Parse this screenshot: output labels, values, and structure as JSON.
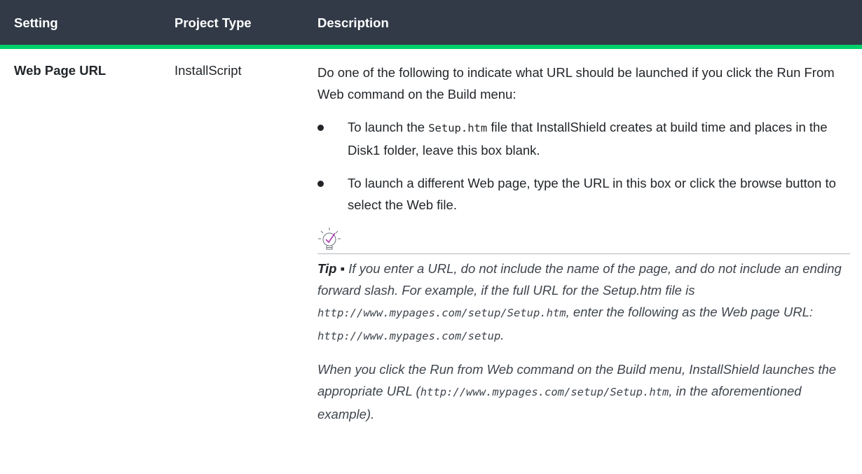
{
  "table": {
    "headers": {
      "setting": "Setting",
      "project_type": "Project Type",
      "description": "Description"
    },
    "row": {
      "setting": "Web Page URL",
      "project_type": "InstallScript",
      "intro": "Do one of the following to indicate what URL should be launched if you click the Run From Web command on the Build menu:",
      "bullets": [
        {
          "before": "To launch the ",
          "code": "Setup.htm",
          "after": " file that InstallShield creates at build time and places in the Disk1 folder, leave this box blank."
        },
        {
          "text": "To launch a different Web page, type the URL in this box or click the browse button to select the Web file."
        }
      ],
      "tip": {
        "icon": "lightbulb-check-icon",
        "label": "Tip",
        "separator": " ▪ ",
        "p1_a": "If you enter a URL, do not include the name of the page, and do not include an ending forward slash. For example, if the full URL for the Setup.htm file is ",
        "p1_code1": "http://www.mypages.com/setup/Setup.htm",
        "p1_b": ", enter the following as the Web page URL: ",
        "p1_code2": "http://www.mypages.com/setup",
        "p1_c": ".",
        "p2_a": "When you click the Run from Web command on the Build menu, InstallShield launches the appropriate URL (",
        "p2_code": "http://www.mypages.com/setup/Setup.htm",
        "p2_b": ", in the aforementioned example)."
      }
    }
  },
  "colors": {
    "header_bg": "#323a47",
    "header_stripe": "#00d06a",
    "icon_accent": "#b03ab0"
  }
}
